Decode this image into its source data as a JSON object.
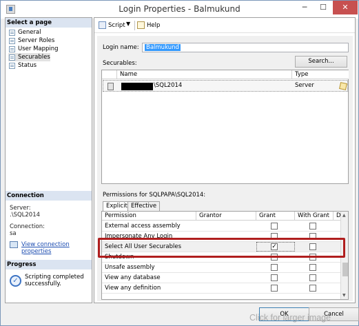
{
  "window": {
    "title": "Login Properties - Balmukund",
    "minimize": "─",
    "maximize": "☐",
    "close": "✕"
  },
  "sidebar": {
    "select_page_header": "Select a page",
    "pages": [
      {
        "label": "General"
      },
      {
        "label": "Server Roles"
      },
      {
        "label": "User Mapping"
      },
      {
        "label": "Securables"
      },
      {
        "label": "Status"
      }
    ],
    "connection_header": "Connection",
    "server_label": "Server:",
    "server_value": ".\\SQL2014",
    "connection_label": "Connection:",
    "connection_value": "sa",
    "view_connection_link": "View connection properties",
    "progress_header": "Progress",
    "progress_text": "Scripting completed successfully."
  },
  "toolbar": {
    "script_label": "Script",
    "script_arrow": "▼",
    "help_label": "Help"
  },
  "main": {
    "login_name_label": "Login name:",
    "login_name_value": "Balmukund",
    "securables_label": "Securables:",
    "search_button": "Search...",
    "securables_columns": [
      "Name",
      "Type"
    ],
    "securables_rows": [
      {
        "name": "\\SQL2014",
        "type": "Server"
      }
    ],
    "permissions_label": "Permissions for SQLPAPA\\SQL2014:",
    "tabs": [
      "Explicit",
      "Effective"
    ],
    "permission_columns": [
      "Permission",
      "Grantor",
      "Grant",
      "With Grant",
      "D"
    ],
    "permission_rows": [
      {
        "name": "External access assembly",
        "grant": false
      },
      {
        "name": "Impersonate Any Login",
        "grant": false
      },
      {
        "name": "Select All User Securables",
        "grant": true
      },
      {
        "name": "Shutdown",
        "grant": false
      },
      {
        "name": "Unsafe assembly",
        "grant": false
      },
      {
        "name": "View any database",
        "grant": false
      },
      {
        "name": "View any definition",
        "grant": false
      }
    ]
  },
  "buttons": {
    "ok": "OK",
    "cancel": "Cancel"
  },
  "watermark": "Click for larger image",
  "colors": {
    "highlight": "#b01e1e",
    "link": "#1a4bb0",
    "selection": "#3399ff"
  }
}
